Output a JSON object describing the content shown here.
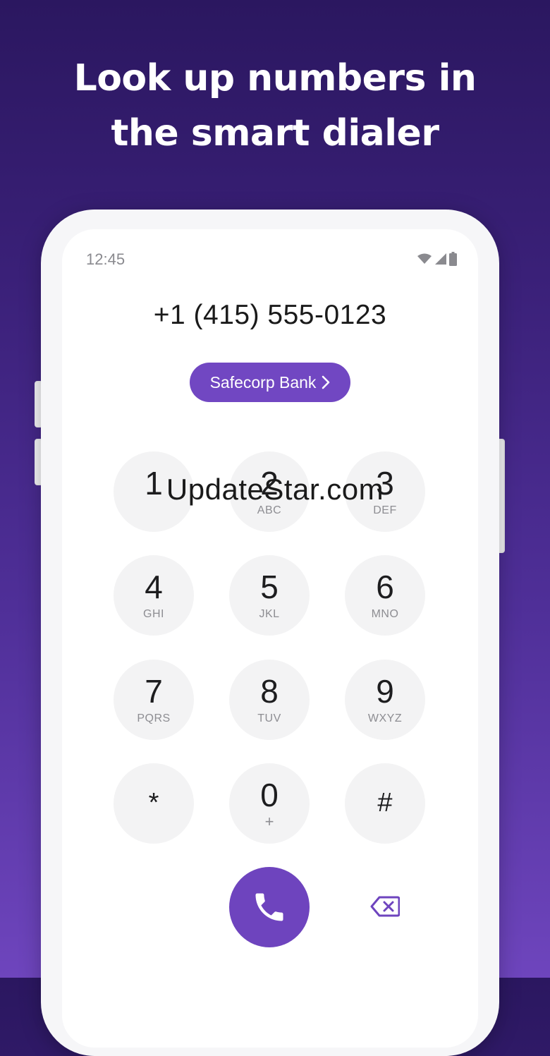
{
  "headline": {
    "line1": "Look up numbers in",
    "line2": "the smart dialer"
  },
  "status_bar": {
    "time": "12:45",
    "icons": [
      "wifi-icon",
      "signal-icon",
      "battery-icon"
    ]
  },
  "dialer": {
    "number": "+1 (415) 555-0123",
    "caller_id": "Safecorp Bank",
    "keys": [
      {
        "digit": "1",
        "letters": ""
      },
      {
        "digit": "2",
        "letters": "ABC"
      },
      {
        "digit": "3",
        "letters": "DEF"
      },
      {
        "digit": "4",
        "letters": "GHI"
      },
      {
        "digit": "5",
        "letters": "JKL"
      },
      {
        "digit": "6",
        "letters": "MNO"
      },
      {
        "digit": "7",
        "letters": "PQRS"
      },
      {
        "digit": "8",
        "letters": "TUV"
      },
      {
        "digit": "9",
        "letters": "WXYZ"
      },
      {
        "digit": "*",
        "letters": ""
      },
      {
        "digit": "0",
        "letters": "+"
      },
      {
        "digit": "#",
        "letters": ""
      }
    ],
    "call_icon": "phone-icon",
    "delete_icon": "backspace-icon"
  },
  "watermark": "UpdateStar.com",
  "colors": {
    "accent": "#6e44be",
    "key_bg": "#f3f3f4",
    "background_top": "#2b1760",
    "background_bottom": "#6e45bd"
  }
}
